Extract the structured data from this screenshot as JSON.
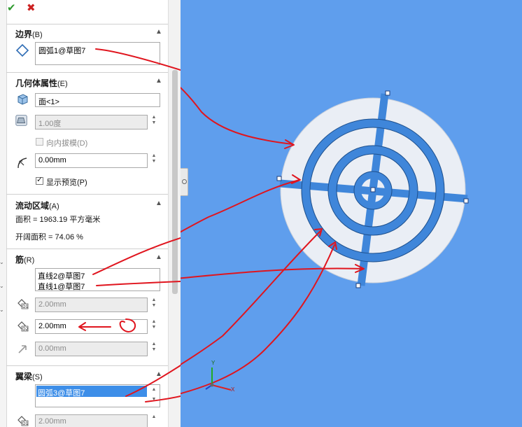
{
  "toolbar": {
    "ok_icon": "✔",
    "cancel_icon": "✖"
  },
  "boundary": {
    "title": "边界",
    "key": "(B)",
    "item": "圆弧1@草图7"
  },
  "geometry": {
    "title": "几何体属性",
    "key": "(E)",
    "face": "面<1>",
    "draft_angle": "1.00度",
    "draft_inward_label": "向内拔模(D)",
    "offset": "0.00mm",
    "preview_label": "显示预览(P)",
    "preview_checked": true
  },
  "flow": {
    "title": "流动区域",
    "key": "(A)",
    "area": "面积 = 1963.19 平方毫米",
    "open_area": "开阔面积 = 74.06 %"
  },
  "ribs": {
    "title": "筋",
    "key": "(R)",
    "items": [
      "直线2@草图7",
      "直线1@草图7"
    ],
    "d1": "2.00mm",
    "d2": "2.00mm",
    "offset": "0.00mm"
  },
  "spar": {
    "title": "翼梁",
    "key": "(S)",
    "item": "圆弧3@草图7",
    "d1": "2.00mm"
  },
  "triad": {
    "x": "X",
    "y": "Y"
  },
  "colors": {
    "viewport": "#5f9eed",
    "part_blue": "#3d86db",
    "part_white": "#e8ecf3",
    "annotation_red": "#e0151e"
  }
}
